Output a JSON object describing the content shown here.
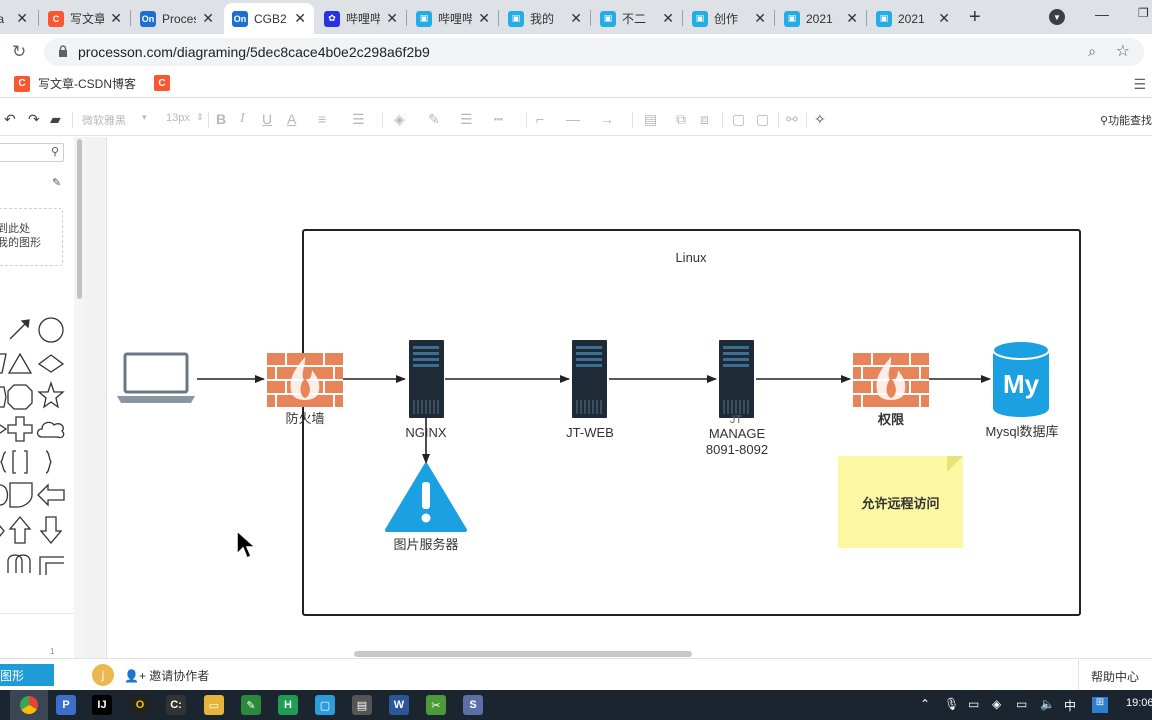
{
  "browser": {
    "tabs": [
      {
        "label": "写文章",
        "favicon": "csdn-icon",
        "color": "#f95730",
        "glyph": "C"
      },
      {
        "label": "Processon",
        "favicon": "processon-icon",
        "color": "#1f6fd1",
        "glyph": "On"
      },
      {
        "label": "CGB2",
        "favicon": "processon-icon",
        "color": "#1f6fd1",
        "glyph": "On",
        "active": true
      },
      {
        "label": "哔哩哔哩",
        "favicon": "baidu-paw-icon",
        "color": "#2932e1",
        "glyph": "✿"
      },
      {
        "label": "哔哩哔哩",
        "favicon": "bilibili-icon",
        "color": "#23ade5",
        "glyph": "▣"
      },
      {
        "label": "我的",
        "favicon": "bilibili-icon",
        "color": "#23ade5",
        "glyph": "▣"
      },
      {
        "label": "不二",
        "favicon": "bilibili-icon",
        "color": "#23ade5",
        "glyph": "▣"
      },
      {
        "label": "创作",
        "favicon": "bilibili-icon",
        "color": "#23ade5",
        "glyph": "▣"
      },
      {
        "label": "2021",
        "favicon": "bilibili-icon",
        "color": "#23ade5",
        "glyph": "▣"
      },
      {
        "label": "2021",
        "favicon": "bilibili-icon",
        "color": "#23ade5",
        "glyph": "▣"
      }
    ],
    "url": "processon.com/diagraming/5dec8cace4b0e2c298a6f2b9",
    "bookmarks": [
      {
        "label": "写文章-CSDN博客",
        "glyph": "C"
      },
      {
        "label": "",
        "glyph": "C"
      }
    ]
  },
  "toolbar": {
    "font_name": "微软雅黑",
    "font_size": "13px",
    "feature_search": "功能查找"
  },
  "left_panel": {
    "drop_hint_line1": "拖拽到此处",
    "drop_hint_line2": "添加我的图形",
    "page_number": "1"
  },
  "diagram": {
    "container_label": "Linux",
    "nodes": {
      "firewall1": "防火墙",
      "nginx": "NGINX",
      "jtweb": "JT-WEB",
      "manage_line1": "MANAGE",
      "manage_line2": "8091-8092",
      "manage_top": "JT",
      "firewall2": "权限",
      "mysql": "Mysql数据库",
      "mysql_logo": "My",
      "image_server": "图片服务器"
    },
    "note_text": "允许远程访问",
    "colors": {
      "firewall": "#e8845a",
      "server": "#1e2b37",
      "mysql": "#1ba1e2",
      "warning": "#1ba1e2",
      "note": "#fbf7a3"
    }
  },
  "status_bar": {
    "more_shapes": "更多图形",
    "avatar_letter": "j",
    "invite": "邀请协作者",
    "help": "帮助中心"
  },
  "taskbar": {
    "ime": "中",
    "clock": "19:06"
  }
}
